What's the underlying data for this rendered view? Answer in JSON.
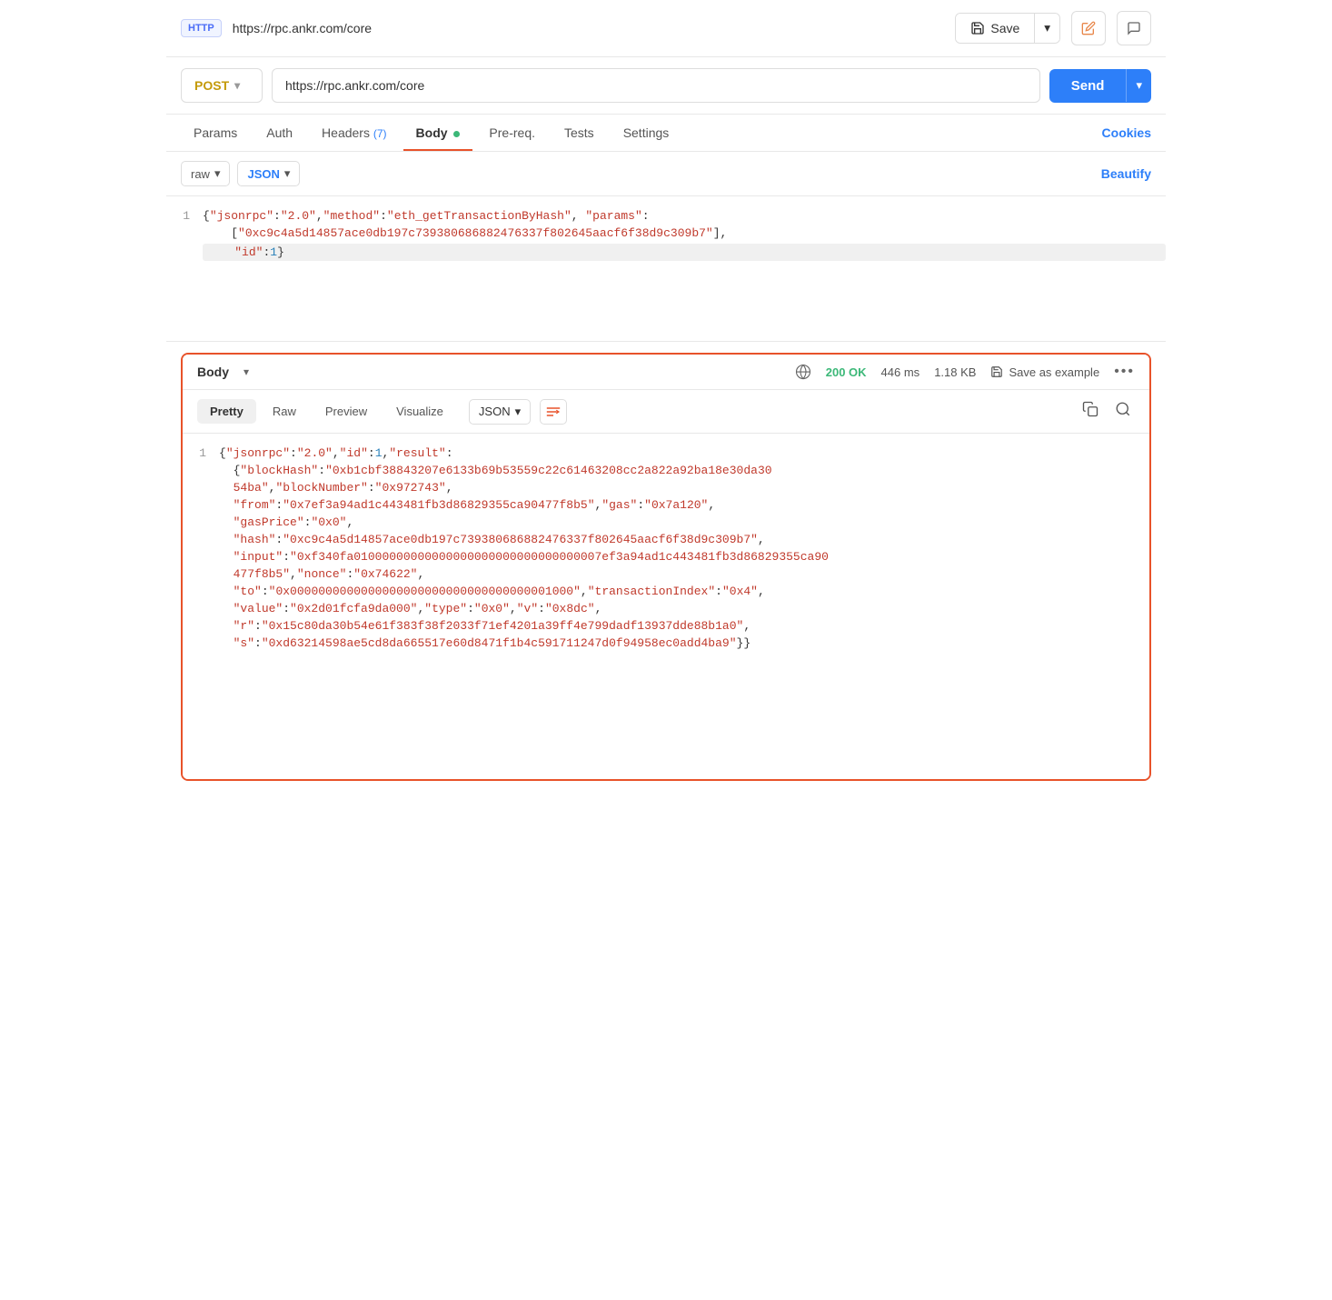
{
  "topbar": {
    "badge": "HTTP",
    "url": "https://rpc.ankr.com/core",
    "save_label": "Save",
    "save_dropdown_icon": "▾",
    "pencil_icon": "✏",
    "comment_icon": "💬"
  },
  "urlbar": {
    "method": "POST",
    "url": "https://rpc.ankr.com/core",
    "send_label": "Send",
    "method_chevron": "▾",
    "send_chevron": "▾"
  },
  "tabs": [
    {
      "id": "params",
      "label": "Params",
      "badge": null,
      "dot": false,
      "active": false
    },
    {
      "id": "auth",
      "label": "Auth",
      "badge": null,
      "dot": false,
      "active": false
    },
    {
      "id": "headers",
      "label": "Headers",
      "badge": "(7)",
      "dot": false,
      "active": false
    },
    {
      "id": "body",
      "label": "Body",
      "badge": null,
      "dot": true,
      "active": true
    },
    {
      "id": "prereq",
      "label": "Pre-req.",
      "badge": null,
      "dot": false,
      "active": false
    },
    {
      "id": "tests",
      "label": "Tests",
      "badge": null,
      "dot": false,
      "active": false
    },
    {
      "id": "settings",
      "label": "Settings",
      "badge": null,
      "dot": false,
      "active": false
    }
  ],
  "cookies_label": "Cookies",
  "editor_toolbar": {
    "format1": "raw",
    "format2": "JSON",
    "chevron": "▾",
    "beautify": "Beautify"
  },
  "request_body": {
    "line1": "{\"jsonrpc\":\"2.0\",\"method\":\"eth_getTransactionByHash\", \"params\":",
    "line2": "[\"0xc9c4a5d14857ace0db197c739380686882476337f802645aacf6f38d9c309b7\"],",
    "line3": "\"id\":1}"
  },
  "response": {
    "body_label": "Body",
    "status": "200 OK",
    "duration": "446 ms",
    "size": "1.18 KB",
    "save_example": "Save as example",
    "more_icon": "•••",
    "tabs": [
      "Pretty",
      "Raw",
      "Preview",
      "Visualize"
    ],
    "active_tab": "Pretty",
    "format": "JSON",
    "content": {
      "line1": "{\"jsonrpc\":\"2.0\",\"id\":1,\"result\":",
      "line2": "  {\"blockHash\":\"0xb1cbf38843207e6133b69b53559c22c61463208cc2a822a92ba18e30da30",
      "line3": "  54ba\",\"blockNumber\":\"0x972743\",",
      "line4": "  \"from\":\"0x7ef3a94ad1c443481fb3d86829355ca90477f8b5\",\"gas\":\"0x7a120\",",
      "line5": "  \"gasPrice\":\"0x0\",",
      "line6": "  \"hash\":\"0xc9c4a5d14857ace0db197c739380686882476337f802645aacf6f38d9c309b7\",",
      "line7": "  \"input\":\"0xf340fa01000000000000000000000000000000007ef3a94ad1c443481fb3d86829355ca90",
      "line8": "  477f8b5\",\"nonce\":\"0x74622\",",
      "line9": "  \"to\":\"0x0000000000000000000000000000000000001000\",\"transactionIndex\":\"0x4\",",
      "line10": "  \"value\":\"0x2d01fcfa9da000\",\"type\":\"0x0\",\"v\":\"0x8dc\",",
      "line11": "  \"r\":\"0x15c80da30b54e61f383f38f2033f71ef4201a39ff4e799dadf13937dde88b1a0\",",
      "line12": "  \"s\":\"0xd63214598ae5cd8da665517e60d8471f1b4c591711247d0f94958ec0add4ba9\"}}"
    }
  }
}
